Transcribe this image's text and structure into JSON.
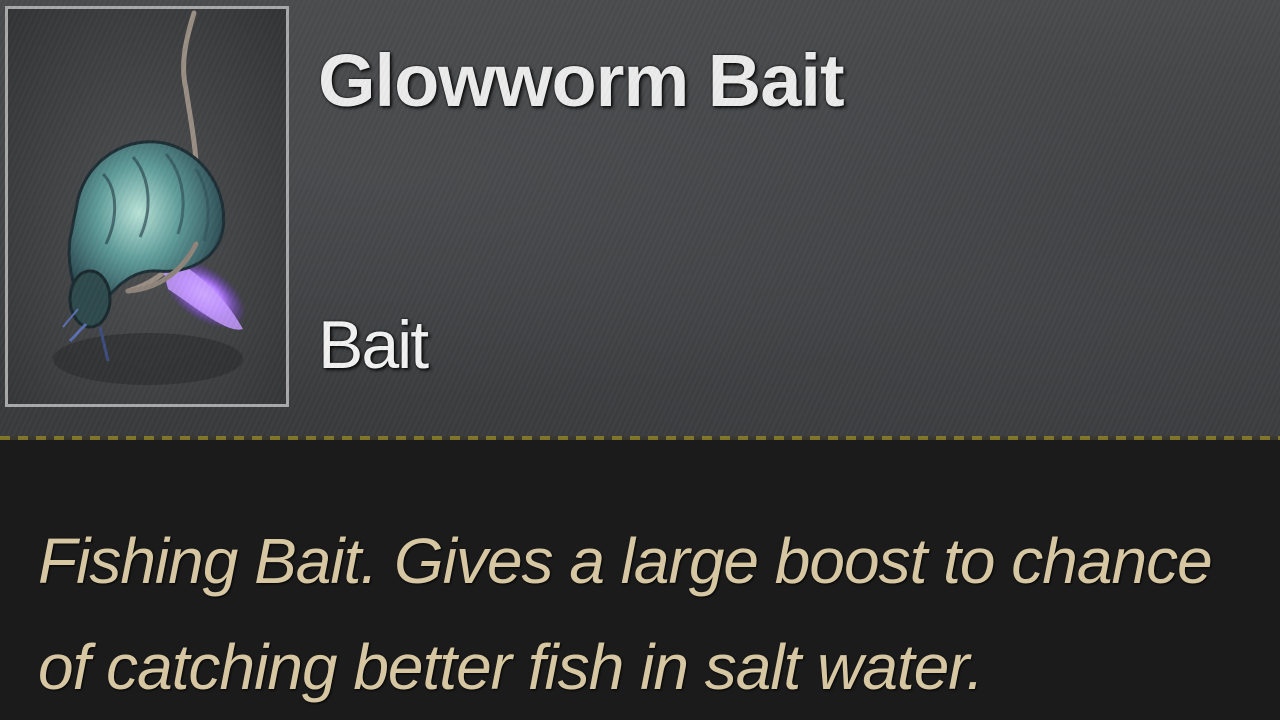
{
  "item": {
    "name": "Glowworm Bait",
    "type": "Bait",
    "icon": "glowworm-bait-icon",
    "description_lines": [
      "Fishing Bait. Gives a large boost to chance",
      "of catching better fish in salt water."
    ]
  },
  "colors": {
    "name_text": "#ececec",
    "description_text": "#d6c7a2",
    "divider_accent": "#8a7d2a",
    "glow": "#a070ff"
  }
}
